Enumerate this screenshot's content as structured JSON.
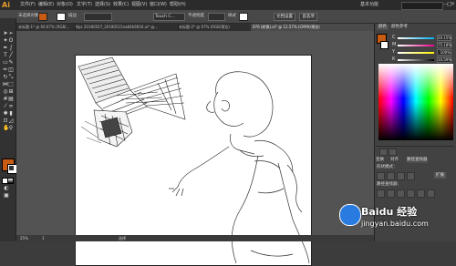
{
  "app": {
    "logo": "Ai",
    "workspace": "基本功能",
    "window_buttons": [
      "—",
      "□",
      "✕"
    ]
  },
  "menu": [
    "文件(F)",
    "编辑(E)",
    "对象(O)",
    "文字(T)",
    "选择(S)",
    "效果(C)",
    "视图(V)",
    "窗口(W)",
    "帮助(H)"
  ],
  "control": {
    "selection": "未选择对象",
    "stroke_label": "描边",
    "brush": "Touch C...",
    "opacity_label": "不透明度",
    "style_label": "样式",
    "doc_setup": "文档设置",
    "prefs": "首选项"
  },
  "tabs": [
    {
      "label": "未标题-1* @ 66.67% (RGB/..."
    },
    {
      "label": "Nps 20180507_20180515ea84b9834.ai* @..."
    },
    {
      "label": "未标题-2* @ 67% (RGB/预览)"
    },
    {
      "label": "076 (转换).ai* @ 12.57% (CMYK/预览)"
    }
  ],
  "status": {
    "zoom": "25%",
    "page": "1",
    "mode": "选择"
  },
  "panel": {
    "tabs": [
      "颜色",
      "颜色参考"
    ],
    "channels": [
      {
        "letter": "C",
        "value": "20.15%"
      },
      {
        "letter": "M",
        "value": "75.18%"
      },
      {
        "letter": "Y",
        "value": "100%"
      },
      {
        "letter": "K",
        "value": "10.59%"
      }
    ],
    "pathfinder_tabs": [
      "变换",
      "对齐",
      "路径查找器"
    ],
    "shape_mode_label": "形状模式：",
    "pathfinder_label": "路径查找器：",
    "expand_button": "扩展"
  },
  "watermark": {
    "text": "Baidu 经验",
    "url": "jingyan.baidu.com"
  },
  "colors": {
    "fill": "#c75b12",
    "accent": "#e69a2e"
  }
}
